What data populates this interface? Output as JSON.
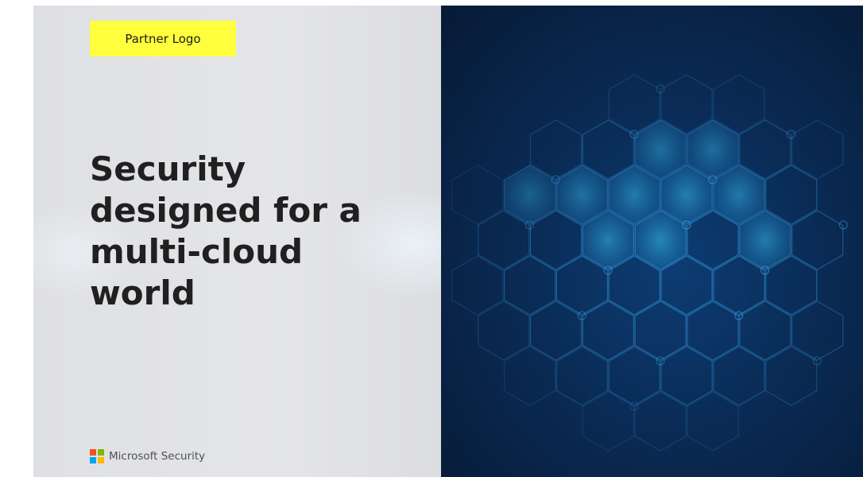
{
  "partner_logo": {
    "label": "Partner Logo",
    "bg_color": "#ffff3d"
  },
  "headline": {
    "lines": [
      "Security",
      "designed for a",
      "multi-cloud",
      "world"
    ]
  },
  "footer": {
    "brand": "Microsoft Security",
    "logo_icon": "microsoft-logo-icon",
    "logo_colors": [
      "#f25022",
      "#7fba00",
      "#00a4ef",
      "#ffb900"
    ]
  },
  "hero_image": {
    "icon": "hexagon-network-pattern",
    "colors": [
      "#071a35",
      "#0d3d74",
      "#1a7fbf",
      "#2fa8d8"
    ]
  }
}
